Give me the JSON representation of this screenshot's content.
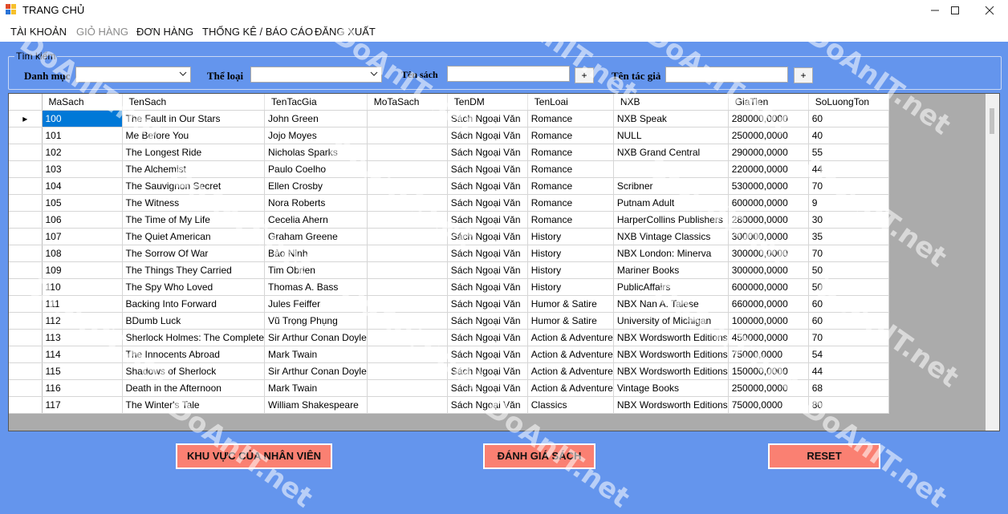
{
  "window": {
    "title": "TRANG CHỦ",
    "minimize_icon": "minimize-icon",
    "maximize_icon": "maximize-icon",
    "close_icon": "close-icon"
  },
  "menu": [
    {
      "label": "TÀI KHOẢN",
      "enabled": true
    },
    {
      "label": "GIỎ HÀNG",
      "enabled": false
    },
    {
      "label": "ĐƠN HÀNG",
      "enabled": true
    },
    {
      "label": "THỐNG KÊ / BÁO CÁO",
      "enabled": true
    },
    {
      "label": "ĐĂNG XUẤT",
      "enabled": true
    }
  ],
  "search": {
    "group_label": "Tìm kiếm",
    "category_label": "Danh mục",
    "category_value": "",
    "genre_label": "Thể loại",
    "genre_value": "",
    "book_name_label": "Tên sách",
    "book_name_value": "",
    "author_label": "Tên tác giả",
    "author_value": "",
    "plus_label": "+"
  },
  "grid": {
    "columns": [
      "MaSach",
      "TenSach",
      "TenTacGia",
      "MoTaSach",
      "TenDM",
      "TenLoai",
      "NXB",
      "GiaTien",
      "SoLuongTon"
    ],
    "current_row_marker": "▸",
    "rows": [
      [
        "100",
        "The Fault in Our Stars",
        "John Green",
        "",
        "Sách Ngoại Văn",
        "Romance",
        "NXB Speak",
        "280000,0000",
        "60"
      ],
      [
        "101",
        "Me Before You",
        "Jojo Moyes",
        "",
        "Sách Ngoại Văn",
        "Romance",
        "NULL",
        "250000,0000",
        "40"
      ],
      [
        "102",
        "The Longest Ride",
        "Nicholas Sparks",
        "",
        "Sách Ngoại Văn",
        "Romance",
        "NXB Grand Central",
        "290000,0000",
        "55"
      ],
      [
        "103",
        "The Alchemist",
        "Paulo Coelho",
        "",
        "Sách Ngoại Văn",
        "Romance",
        "",
        "220000,0000",
        "44"
      ],
      [
        "104",
        "The Sauvignon Secret",
        "Ellen Crosby",
        "",
        "Sách Ngoại Văn",
        "Romance",
        "Scribner",
        "530000,0000",
        "70"
      ],
      [
        "105",
        "The Witness",
        "Nora Roberts",
        "",
        "Sách Ngoại Văn",
        "Romance",
        "Putnam Adult",
        "600000,0000",
        "9"
      ],
      [
        "106",
        "The Time of My Life",
        "Cecelia Ahern",
        "",
        "Sách Ngoại Văn",
        "Romance",
        "HarperCollins Publishers",
        "280000,0000",
        "30"
      ],
      [
        "107",
        "The Quiet American",
        "Graham Greene",
        "",
        "Sách Ngoại Văn",
        "History",
        "NXB Vintage Classics",
        "300000,0000",
        "35"
      ],
      [
        "108",
        "The Sorrow Of War",
        "Bảo Ninh",
        "",
        "Sách Ngoại Văn",
        "History",
        "NBX London: Minerva",
        "300000,0000",
        "70"
      ],
      [
        "109",
        "The Things They Carried",
        "Tim Obrien",
        "",
        "Sách Ngoại Văn",
        "History",
        "Mariner Books",
        "300000,0000",
        "50"
      ],
      [
        "110",
        "The Spy Who Loved",
        "Thomas A. Bass",
        "",
        "Sách Ngoại Văn",
        "History",
        "PublicAffairs",
        "600000,0000",
        "50"
      ],
      [
        "111",
        "Backing Into Forward",
        "Jules Feiffer",
        "",
        "Sách Ngoại Văn",
        "Humor & Satire",
        "NBX Nan A. Talese",
        "660000,0000",
        "60"
      ],
      [
        "112",
        "BDumb Luck",
        "Vũ Trọng Phụng",
        "",
        "Sách Ngoại Văn",
        "Humor & Satire",
        "University of Michigan",
        "100000,0000",
        "60"
      ],
      [
        "113",
        "Sherlock Holmes: The Complete",
        "Sir Arthur Conan Doyle",
        "",
        "Sách Ngoại Văn",
        "Action & Adventure",
        "NBX Wordsworth Editions",
        "450000,0000",
        "70"
      ],
      [
        "114",
        "The Innocents Abroad",
        "Mark Twain",
        "",
        "Sách Ngoại Văn",
        "Action & Adventure",
        "NBX Wordsworth Editions",
        "75000,0000",
        "54"
      ],
      [
        "115",
        "Shadows of Sherlock",
        "Sir Arthur Conan Doyle",
        "",
        "Sách Ngoại Văn",
        "Action & Adventure",
        "NBX Wordsworth Editions",
        "150000,0000",
        "44"
      ],
      [
        "116",
        "Death in the Afternoon",
        "Mark Twain",
        "",
        "Sách Ngoại Văn",
        "Action & Adventure",
        "Vintage Books",
        "250000,0000",
        "68"
      ],
      [
        "117",
        "The Winter's Tale",
        "William Shakespeare",
        "",
        "Sách Ngoại Văn",
        "Classics",
        "NBX Wordsworth Editions",
        "75000,0000",
        "80"
      ]
    ]
  },
  "buttons": {
    "staff_area": "KHU VỰC CỦA NHÂN VIÊN",
    "rate_books": "ĐÁNH GIÁ SÁCH",
    "reset": "RESET"
  },
  "watermark": {
    "text": "DoAnIT.net"
  },
  "colors": {
    "background": "#6495ED",
    "button": "#FA8072",
    "selection": "#0078D7"
  }
}
